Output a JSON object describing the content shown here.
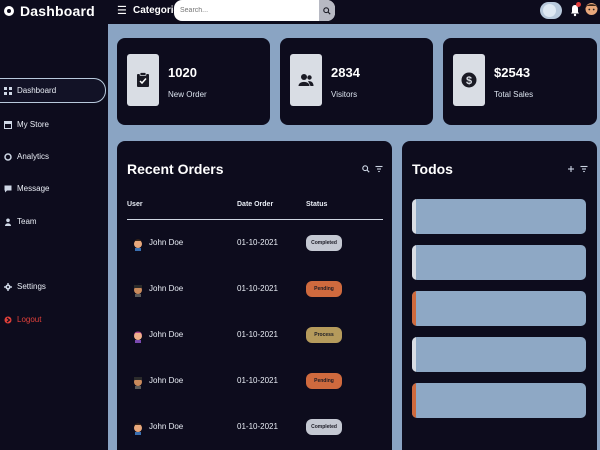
{
  "header": {
    "brand": "Dashboard",
    "categories_label": "Categories",
    "search_placeholder": "Search...",
    "search_value": ""
  },
  "sidebar": {
    "items": [
      {
        "label": "Dashboard",
        "icon": "grid-icon"
      },
      {
        "label": "My Store",
        "icon": "store-icon"
      },
      {
        "label": "Analytics",
        "icon": "analytics-icon"
      },
      {
        "label": "Message",
        "icon": "message-icon"
      },
      {
        "label": "Team",
        "icon": "team-icon"
      },
      {
        "label": "Settings",
        "icon": "gear-icon"
      },
      {
        "label": "Logout",
        "icon": "logout-icon"
      }
    ],
    "active_index": 0
  },
  "stats": [
    {
      "value": "1020",
      "label": "New Order",
      "icon": "clipboard-check-icon"
    },
    {
      "value": "2834",
      "label": "Visitors",
      "icon": "users-icon"
    },
    {
      "value": "$2543",
      "label": "Total Sales",
      "icon": "dollar-coin-icon"
    }
  ],
  "orders": {
    "title": "Recent Orders",
    "columns": [
      "User",
      "Date Order",
      "Status"
    ],
    "rows": [
      {
        "user": "John Doe",
        "date": "01-10-2021",
        "status": "Completed"
      },
      {
        "user": "John Doe",
        "date": "01-10-2021",
        "status": "Pending"
      },
      {
        "user": "John Doe",
        "date": "01-10-2021",
        "status": "Process"
      },
      {
        "user": "John Doe",
        "date": "01-10-2021",
        "status": "Pending"
      },
      {
        "user": "John Doe",
        "date": "01-10-2021",
        "status": "Completed"
      }
    ]
  },
  "todos": {
    "title": "Todos",
    "items": [
      {
        "status": "completed"
      },
      {
        "status": "completed"
      },
      {
        "status": "not-completed"
      },
      {
        "status": "completed"
      },
      {
        "status": "not-completed"
      }
    ]
  },
  "colors": {
    "background": "#8aa4c3",
    "panel": "#0d0c1d",
    "completed": "#c4c8d2",
    "pending": "#cf6a3e",
    "process": "#b59b5c",
    "todo_bar_completed": "#d9dde4",
    "todo_bar_pending": "#cf6a3e",
    "logout": "#e0403a"
  }
}
